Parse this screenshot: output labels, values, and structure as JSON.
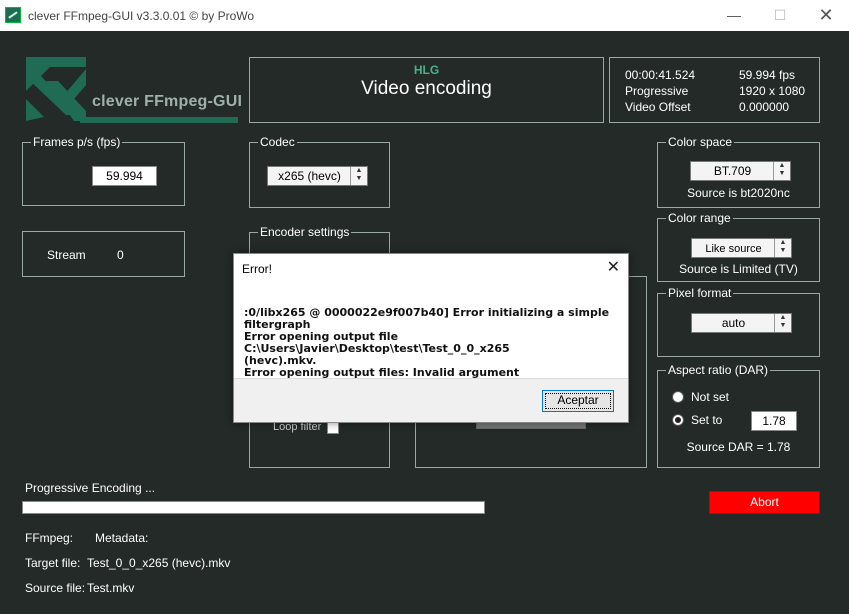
{
  "window": {
    "title": "clever FFmpeg-GUI v3.3.0.01   © by ProWo",
    "min": "—",
    "max": "☐",
    "close": "✕"
  },
  "logo": {
    "text": "clever FFmpeg-GUI"
  },
  "header": {
    "hlg": "HLG",
    "title": "Video encoding",
    "info": {
      "time": "00:00:41.524",
      "fps": "59.994 fps",
      "scan": "Progressive",
      "resolution": "1920 x 1080",
      "offset_label": "Video Offset",
      "offset_value": "0.000000"
    }
  },
  "fps_panel": {
    "title": "Frames p/s (fps)",
    "value": "59.994"
  },
  "stream_panel": {
    "label": "Stream",
    "value": "0"
  },
  "codec_panel": {
    "title": "Codec",
    "value": "x265 (hevc)"
  },
  "encoder_panel": {
    "title": "Encoder settings",
    "loop_filter": "Loop filter"
  },
  "color_space": {
    "title": "Color space",
    "value": "BT.709",
    "source": "Source is bt2020nc"
  },
  "color_range": {
    "title": "Color range",
    "value": "Like source",
    "source": "Source is Limited (TV)"
  },
  "pixel_format": {
    "title": "Pixel format",
    "value": "auto"
  },
  "aspect_ratio": {
    "title": "Aspect ratio (DAR)",
    "not_set": "Not set",
    "set_to": "Set to",
    "value": "1.78",
    "source": "Source DAR = 1.78"
  },
  "status": {
    "progress_label": "Progressive Encoding ...",
    "abort": "Abort",
    "ffmpeg_label": "FFmpeg:",
    "metadata_label": "Metadata:",
    "target_label": "Target file:",
    "target_value": "Test_0_0_x265 (hevc).mkv",
    "source_label": "Source file:",
    "source_value": "Test.mkv"
  },
  "dialog": {
    "title": "Error!",
    "close": "✕",
    "line1": ":0/libx265 @ 0000022e9f007b40] Error initializing a simple filtergraph",
    "line2": "Error opening output file C:\\Users\\Javier\\Desktop\\test\\Test_0_0_x265",
    "line3": "(hevc).mkv.",
    "line4": "Error opening output files: Invalid argument",
    "ok": "Aceptar"
  },
  "colors": {
    "background": "#232a27",
    "abort": "#ff0000",
    "logo": "#1f6b53",
    "hlg": "#4ab08a"
  }
}
